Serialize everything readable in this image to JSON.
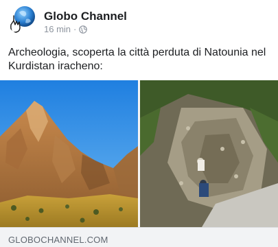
{
  "post": {
    "author": "Globo Channel",
    "timestamp": "16 min",
    "separator": "·",
    "privacy_icon": "globe-icon",
    "text": "Archeologia, scoperta la città perduta di Natounia nel Kurdistan iracheno:"
  },
  "avatar": {
    "icon": "globe-hand-logo"
  },
  "photos": [
    {
      "subject": "mountain-landscape"
    },
    {
      "subject": "excavation-site"
    }
  ],
  "link": {
    "domain": "GLOBOCHANNEL.COM"
  },
  "colors": {
    "author_text": "#1c1e21",
    "meta_text": "#8d949e",
    "link_bar": "#f2f3f5"
  }
}
